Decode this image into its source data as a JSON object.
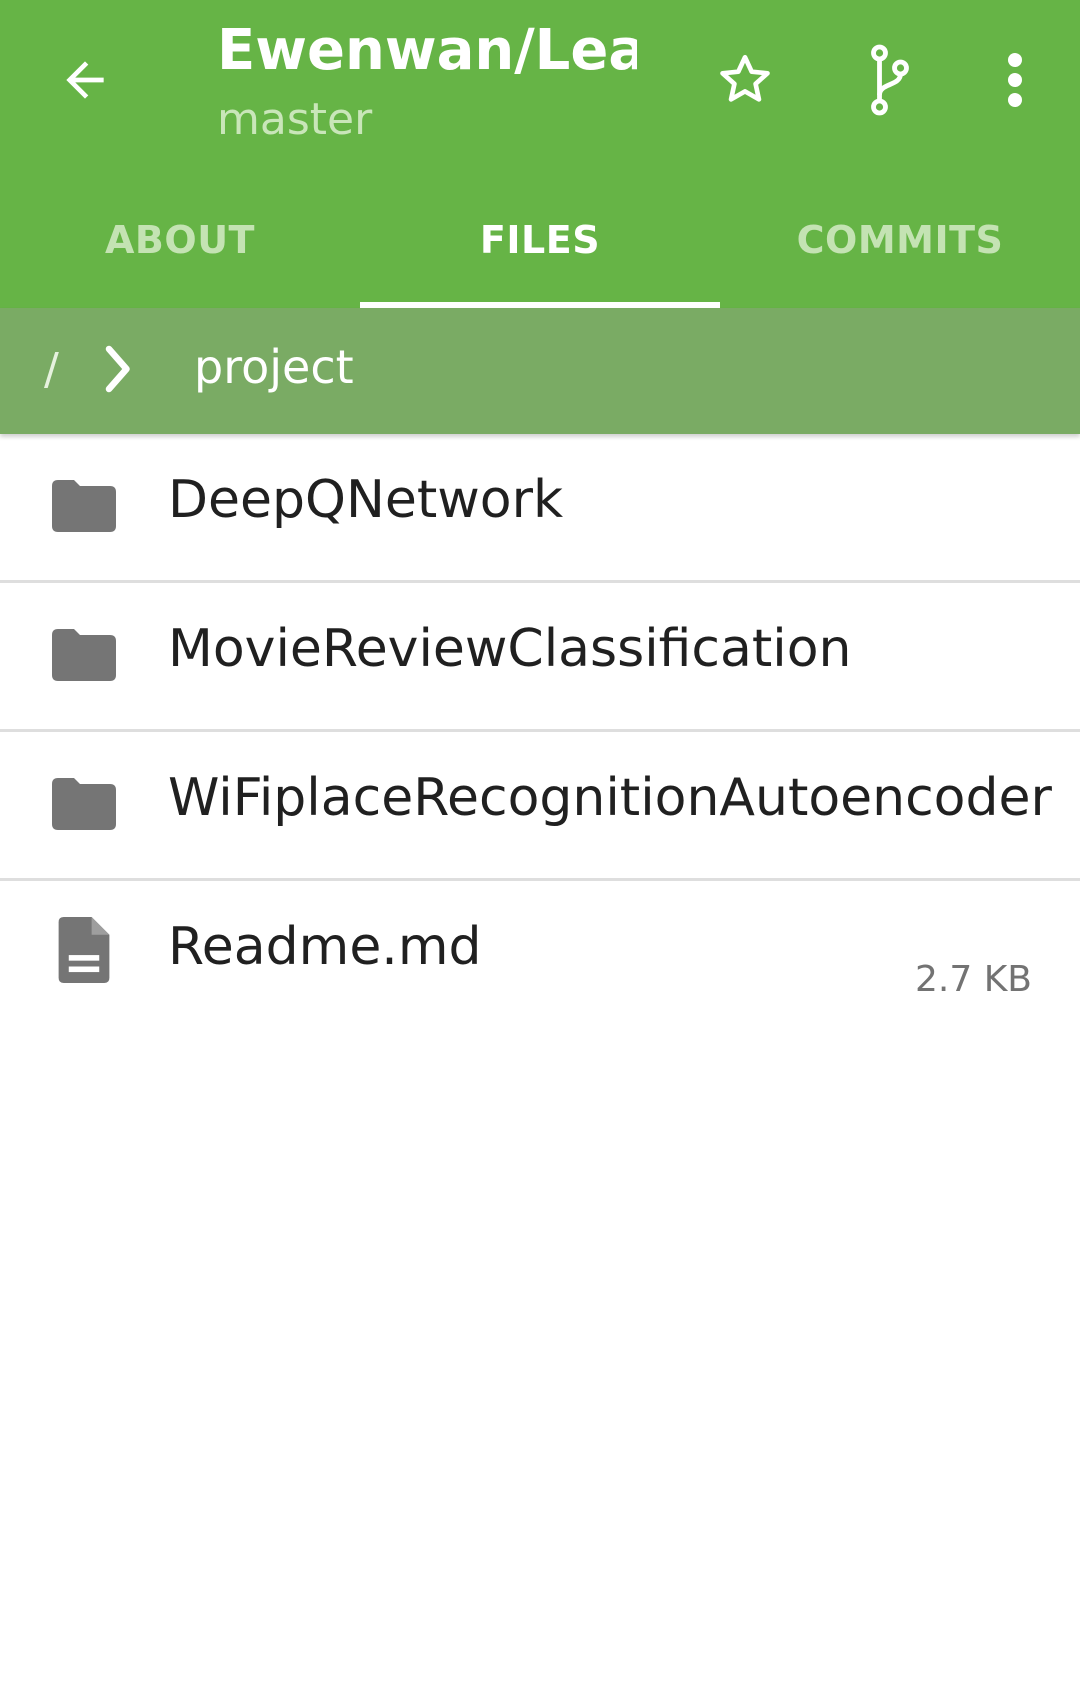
{
  "header": {
    "title": "Ewenwan/Lea…",
    "subtitle": "master",
    "accent_color": "#66b446",
    "icons": {
      "back": "arrow-back-icon",
      "star": "star-outline-icon",
      "branch": "git-branch-icon",
      "more": "more-vert-icon"
    }
  },
  "tabs": [
    {
      "label": "ABOUT",
      "active": false
    },
    {
      "label": "FILES",
      "active": true
    },
    {
      "label": "COMMITS",
      "active": false
    }
  ],
  "breadcrumb": {
    "root": "/",
    "current": "project",
    "background_color": "#7aab64"
  },
  "files": [
    {
      "name": "DeepQNetwork",
      "type": "folder",
      "icon": "folder-icon"
    },
    {
      "name": "MovieReviewClassification",
      "type": "folder",
      "icon": "folder-icon"
    },
    {
      "name": "WiFiplaceRecognitionAutoencoder",
      "type": "folder",
      "icon": "folder-icon"
    },
    {
      "name": "Readme.md",
      "type": "file",
      "icon": "document-icon",
      "size": "2.7 KB"
    }
  ]
}
